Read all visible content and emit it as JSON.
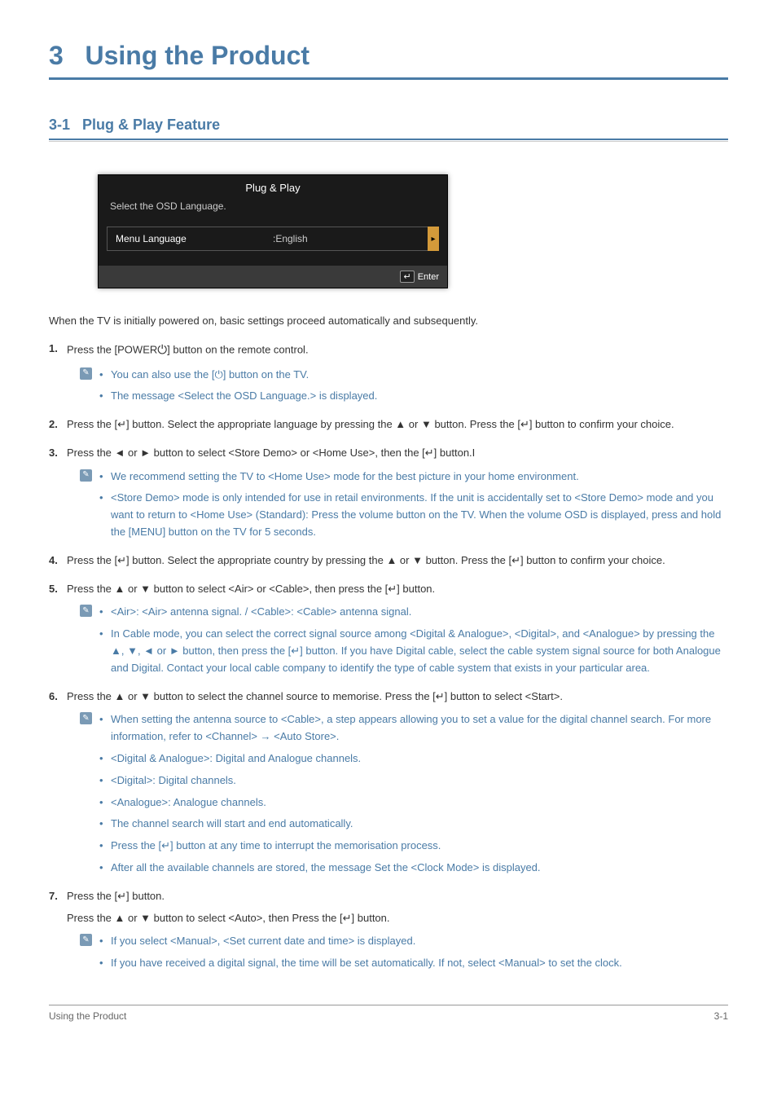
{
  "chapter": {
    "number": "3",
    "title": "Using the Product"
  },
  "section": {
    "number": "3-1",
    "title": "Plug & Play Feature"
  },
  "osd": {
    "title": "Plug & Play",
    "subtitle": "Select the OSD Language.",
    "row_label": "Menu Language",
    "row_value": ":English",
    "row_arrow": "▸",
    "footer_icon": "↵",
    "footer_text": "Enter"
  },
  "intro": "When the TV is initially powered on, basic settings proceed automatically and subsequently.",
  "steps": {
    "s1": {
      "pre": "Press the [POWER",
      "post": "] button on the remote control.",
      "power_glyph": "⏻",
      "notes": [
        "You can also use the [⏻] button on the TV.",
        "The message <Select the OSD Language.> is displayed."
      ]
    },
    "s2": "Press the [↵] button. Select the appropriate language by pressing the ▲ or ▼ button. Press the [↵] button to confirm your choice.",
    "s3": {
      "text": "Press the ◄ or ► button to select <Store Demo> or <Home Use>, then the [↵] button.I",
      "notes": [
        "We recommend setting the TV to <Home Use> mode for the best picture in your home environment.",
        "<Store Demo> mode is only intended for use in retail environments. If the unit is accidentally set to <Store Demo> mode and you want to return to <Home Use> (Standard): Press the volume button on the TV. When the volume OSD is displayed, press and hold the [MENU] button on the TV for 5 seconds."
      ]
    },
    "s4": "Press the [↵] button. Select the appropriate country by pressing the ▲ or ▼ button. Press the [↵] button to confirm your choice.",
    "s5": {
      "text": "Press the ▲ or ▼ button to select <Air> or <Cable>, then press the [↵] button.",
      "notes": [
        "<Air>: <Air> antenna signal. / <Cable>: <Cable> antenna signal.",
        "In Cable mode, you can select the correct signal source among <Digital & Analogue>, <Digital>, and <Analogue> by pressing the ▲, ▼, ◄ or ► button, then press the [↵] button. If you have Digital cable, select the cable system signal source for both Analogue and Digital. Contact your local cable company to identify the type of cable system that exists in your particular area."
      ]
    },
    "s6": {
      "text": "Press the ▲ or ▼ button to select the channel source to memorise. Press the [↵] button to select <Start>.",
      "notes": [
        "When setting the antenna source to <Cable>, a step appears allowing you to set a value for the digital channel search. For more information, refer to <Channel> → <Auto Store>.",
        "<Digital & Analogue>: Digital and Analogue channels.",
        "<Digital>: Digital channels.",
        "<Analogue>: Analogue channels.",
        "The channel search will start and end automatically.",
        "Press the [↵] button at any time to interrupt the memorisation process.",
        "After all the available channels are stored, the message Set the <Clock Mode> is displayed."
      ]
    },
    "s7": {
      "text1": "Press the [↵] button.",
      "text2": "Press the ▲ or ▼ button to select <Auto>, then Press the [↵] button.",
      "notes": [
        "If you select <Manual>, <Set current date and time> is displayed.",
        "If you have received a digital signal, the time will be set automatically. If not, select <Manual> to set the clock."
      ]
    }
  },
  "footer": {
    "left": "Using the Product",
    "right": "3-1"
  }
}
